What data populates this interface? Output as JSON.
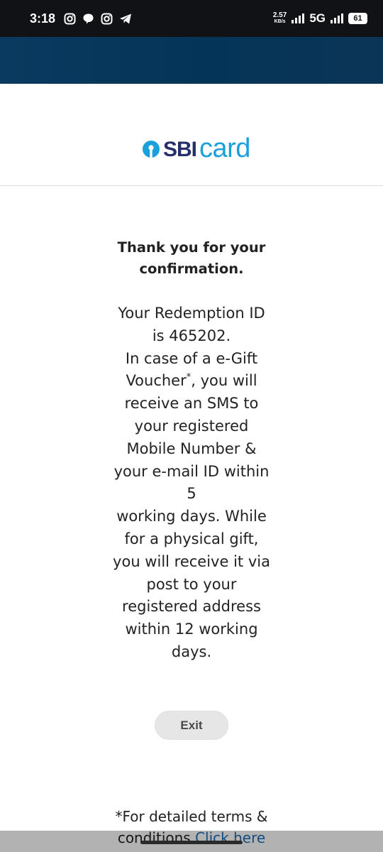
{
  "status_bar": {
    "time": "3:18",
    "speed_value": "2.57",
    "speed_unit": "KB/s",
    "network": "5G",
    "battery": "61",
    "icons": [
      "instagram-icon",
      "chat-bubble-icon",
      "instagram-icon",
      "telegram-icon",
      "signal-icon"
    ]
  },
  "logo": {
    "sbi": "SBI",
    "card": "card",
    "brand_colors": {
      "sbi": "#25306b",
      "card": "#1aa1dc"
    }
  },
  "confirmation": {
    "title_line1": "Thank you for your",
    "title_line2": "confirmation.",
    "lines": {
      "l1": "Your Redemption ID",
      "l2": "is 465202.",
      "l3": "In case of a e-Gift",
      "l4a": "Voucher",
      "l4sup": "*",
      "l4b": ", you will",
      "l5": "receive an SMS to",
      "l6": "your registered",
      "l7": "Mobile Number &",
      "l8": "your e-mail ID within",
      "l9": "5",
      "l10": "working days. While",
      "l11": "for a physical gift,",
      "l12": "you will receive it via",
      "l13": "post to your",
      "l14": "registered address",
      "l15": "within 12 working",
      "l16": "days."
    }
  },
  "exit_button": {
    "label": "Exit"
  },
  "footer": {
    "line1": "*For detailed terms &",
    "line2_prefix": "conditions ",
    "link_text": "Click here"
  },
  "colors": {
    "header_band": "#043558",
    "link": "#1d6fb8",
    "button_bg": "#e6e6e6"
  }
}
